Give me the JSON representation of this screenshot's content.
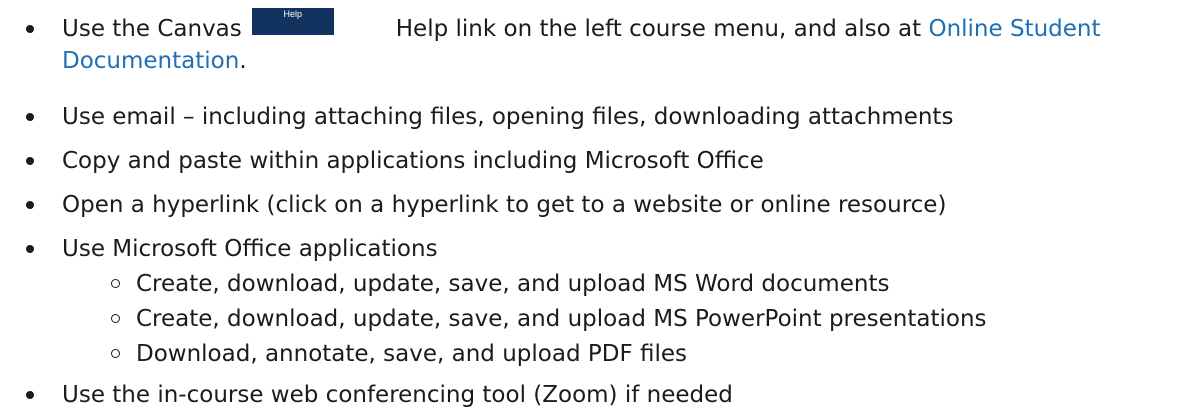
{
  "items": [
    {
      "before_button": "Use the Canvas",
      "button_label": "Help",
      "after_button": "Help link on the left course menu, and also at",
      "link_text_1": "Online Student",
      "link_text_2": "Documentation",
      "trailing": "."
    },
    {
      "text": "Use email – including attaching files, opening files, downloading attachments"
    },
    {
      "text": "Copy and paste within applications including Microsoft Office"
    },
    {
      "text": "Open a hyperlink (click on a hyperlink to get to a website or online resource)"
    },
    {
      "text": "Use Microsoft Office applications"
    },
    {
      "text": "Create, download, update, save, and upload MS Word documents"
    },
    {
      "text": "Create, download, update, save, and upload MS PowerPoint presentations"
    },
    {
      "text": "Download, annotate, save, and upload PDF files"
    },
    {
      "text": "Use the in-course web conferencing tool (Zoom) if needed"
    }
  ],
  "colors": {
    "link": "#1f6fb4",
    "help_button_bg": "#12335f",
    "text": "#1b1b1b"
  }
}
